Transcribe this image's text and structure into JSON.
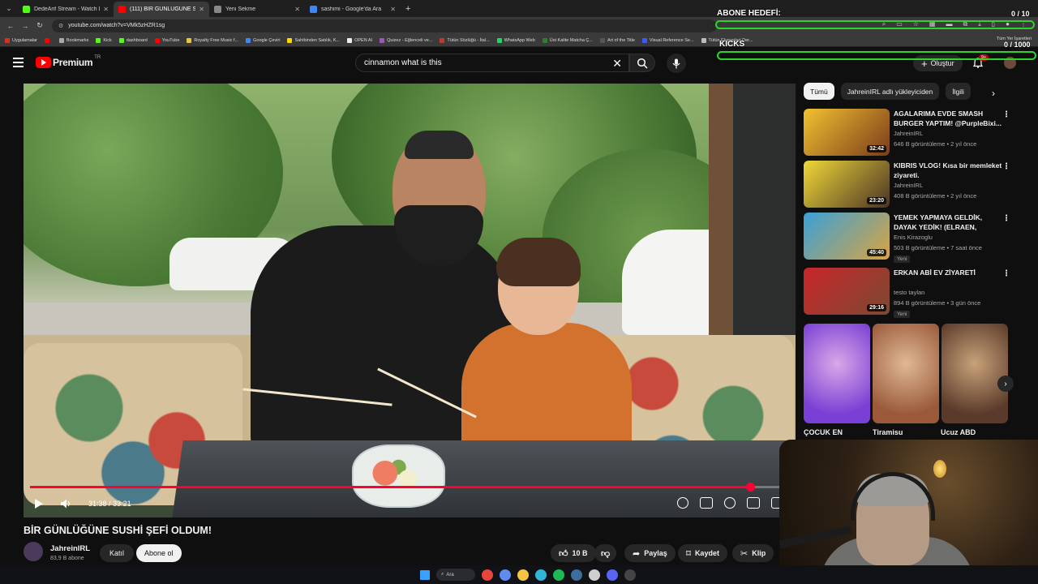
{
  "browser": {
    "tabs": [
      {
        "title": "DedeArif Stream - Watch Live o...",
        "active": false,
        "favicon": "kick",
        "color": "#53fc18"
      },
      {
        "title": "(111) BİR GÜNLÜĞÜNE SUSHİ ŞE...",
        "active": true,
        "favicon": "youtube",
        "color": "#ff0000"
      },
      {
        "title": "Yeni Sekme",
        "active": false,
        "favicon": "chrome",
        "color": "#888888"
      },
      {
        "title": "sashimi - Google'da Ara",
        "active": false,
        "favicon": "google",
        "color": "#4285f4"
      }
    ],
    "url": "youtube.com/watch?v=VMk5zHZR1sg",
    "bookmarks": [
      {
        "label": "Uygulamalar",
        "color": "#d93025"
      },
      {
        "label": "",
        "color": "#ff0000"
      },
      {
        "label": "Bookmarks",
        "color": "#aaaaaa"
      },
      {
        "label": "Kick",
        "color": "#53fc18"
      },
      {
        "label": "dashboard",
        "color": "#53fc18"
      },
      {
        "label": "YouTube",
        "color": "#ff0000"
      },
      {
        "label": "Royalty Free Music f...",
        "color": "#e8c443"
      },
      {
        "label": "Google Çeviri",
        "color": "#4285f4"
      },
      {
        "label": "Sahibinden Satılık, K...",
        "color": "#ffd800"
      },
      {
        "label": "OPEN AI",
        "color": "#eeeeee"
      },
      {
        "label": "Quizez - Eğlenceli ve...",
        "color": "#9b59b6"
      },
      {
        "label": "Tütün Sözlüğü - İtal...",
        "color": "#c0392b"
      },
      {
        "label": "WhatsApp Web",
        "color": "#25d366"
      },
      {
        "label": "Üst Kalite Matcha Ç...",
        "color": "#2e7d32"
      },
      {
        "label": "Art of the Title",
        "color": "#555555"
      },
      {
        "label": "Visual Reference Se...",
        "color": "#3d5afe"
      },
      {
        "label": "Tütün Eksperleri Der...",
        "color": "#bdbdbd"
      }
    ],
    "bookmarks_right": "Tüm Yer İşaretleri"
  },
  "youtube": {
    "logo_text": "Premium",
    "logo_region": "TR",
    "search_query": "cinnamon what is this",
    "create_label": "Oluştur",
    "notif_count": "9+"
  },
  "overlay": {
    "sub_goal_label": "ABONE HEDEFİ:",
    "sub_goal_value": "0 / 10",
    "sub_goal_progress": 0,
    "kicks_label": "KICKS",
    "kicks_value": "0 / 1000",
    "kicks_progress": 0,
    "accent": "#2cd42c"
  },
  "player": {
    "current_time": "31:38",
    "duration": "33:21",
    "progress": 0.9485,
    "accent": "#ff0033"
  },
  "video": {
    "title": "BİR GÜNLÜĞÜNE SUSHİ ŞEFİ OLDUM!",
    "channel": "JahreinIRL",
    "subscribers": "83,9 B abone",
    "join_label": "Katıl",
    "subscribe_label": "Abone ol",
    "likes": "10 B",
    "share_label": "Paylaş",
    "save_label": "Kaydet",
    "clip_label": "Klip"
  },
  "sidebar": {
    "chips": [
      {
        "label": "Tümü",
        "active": true
      },
      {
        "label": "JahreinIRL adlı yükleyiciden",
        "active": false
      },
      {
        "label": "İlgili",
        "active": false
      }
    ],
    "recommendations": [
      {
        "title": "AGALARIMA EVDE SMASH BURGER YAPTIM! @PurpleBixi...",
        "channel": "JahreinIRL",
        "meta": "646 B görüntüleme • 2 yıl önce",
        "duration": "32:42",
        "new": "",
        "thumb": [
          "#f2c230",
          "#7a3b1c"
        ]
      },
      {
        "title": "KIBRIS VLOG! Kısa bir memleket ziyareti.",
        "channel": "JahreinIRL",
        "meta": "408 B görüntüleme • 2 yıl önce",
        "duration": "23:20",
        "new": "",
        "thumb": [
          "#f0d838",
          "#4a3426"
        ]
      },
      {
        "title": "YEMEK YAPMAYA GELDİK, DAYAK YEDİK! (ELRAEN, ERAY,...",
        "channel": "Enis Kirazoglu",
        "meta": "503 B görüntüleme • 7 saat önce",
        "duration": "45:40",
        "new": "Yeni",
        "thumb": [
          "#3aa0d8",
          "#d9a441"
        ]
      },
      {
        "title": "ERKAN ABİ EV ZİYARETİ",
        "channel": "testo taylan",
        "meta": "894 B görüntüleme • 3 gün önce",
        "duration": "29:16",
        "new": "Yeni",
        "thumb": [
          "#c9262b",
          "#7a4a32"
        ]
      }
    ],
    "shorts": [
      {
        "title": "ÇOCUK EN",
        "colors": [
          "#7a3fd4",
          "#d9a8e8"
        ]
      },
      {
        "title": "Tiramisu",
        "colors": [
          "#9a5a3a",
          "#e0b895"
        ]
      },
      {
        "title": "Ucuz ABD",
        "colors": [
          "#5a3a2a",
          "#c9a27a"
        ]
      }
    ]
  },
  "taskbar": {
    "search_label": "Ara",
    "apps": [
      {
        "name": "windows-start-icon",
        "color": "#3aa0ff"
      },
      {
        "name": "chrome-icon",
        "color": "#e8453c"
      },
      {
        "name": "copilot-icon",
        "color": "#5e8cf0"
      },
      {
        "name": "file-explorer-icon",
        "color": "#f5c542"
      },
      {
        "name": "edge-icon",
        "color": "#2fb6d9"
      },
      {
        "name": "spotify-icon",
        "color": "#1db954"
      },
      {
        "name": "steam-icon",
        "color": "#3c6e9c"
      },
      {
        "name": "app-icon",
        "color": "#cfcfcf"
      },
      {
        "name": "discord-icon",
        "color": "#5865f2"
      },
      {
        "name": "obs-icon",
        "color": "#444444"
      }
    ]
  }
}
